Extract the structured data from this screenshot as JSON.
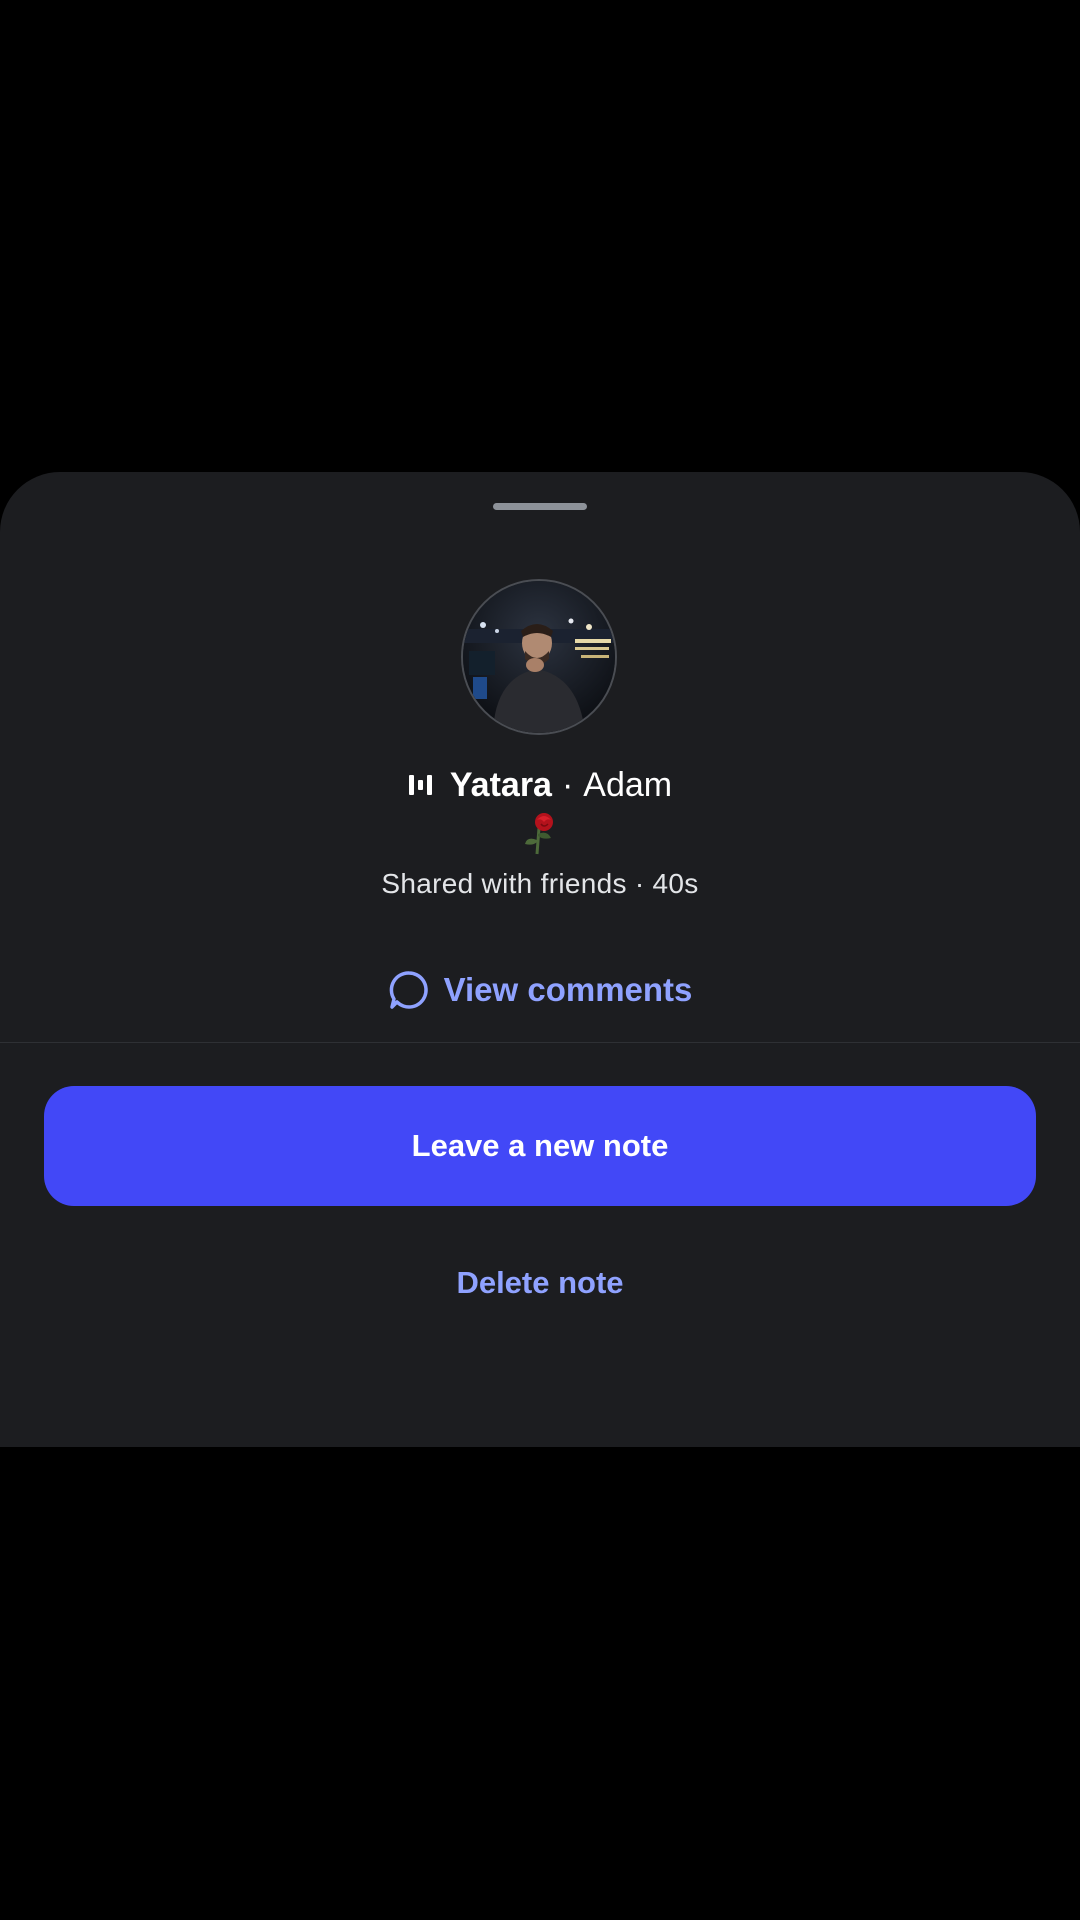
{
  "note": {
    "song": {
      "title": "Yatara",
      "separator": "·",
      "artist": "Adam",
      "icon": "music-bars-icon"
    },
    "emoji": "rose-emoji",
    "meta_text": "Shared with friends · 40s",
    "view_comments_label": "View comments",
    "comment_icon": "chat-bubble-icon"
  },
  "actions": {
    "primary_label": "Leave a new note",
    "secondary_label": "Delete note"
  },
  "colors": {
    "background": "#000000",
    "sheet": "#1c1d20",
    "accent_button": "#4248f7",
    "link": "#8fa2ff",
    "text_primary": "#ffffff",
    "text_secondary": "#e3e5e8"
  }
}
